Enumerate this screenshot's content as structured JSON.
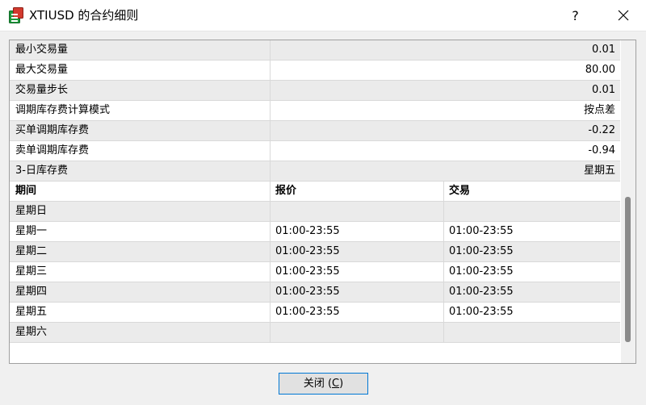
{
  "window": {
    "title": "XTIUSD 的合约细则",
    "help_label": "?"
  },
  "specs": [
    {
      "label": "最小交易量",
      "value": "0.01"
    },
    {
      "label": "最大交易量",
      "value": "80.00"
    },
    {
      "label": "交易量步长",
      "value": "0.01"
    },
    {
      "label": "调期库存费计算模式",
      "value": "按点差"
    },
    {
      "label": "买单调期库存费",
      "value": "-0.22"
    },
    {
      "label": "卖单调期库存费",
      "value": "-0.94"
    },
    {
      "label": "3-日库存费",
      "value": "星期五"
    }
  ],
  "sessions": {
    "headers": [
      "期间",
      "报价",
      "交易"
    ],
    "rows": [
      {
        "day": "星期日",
        "quote": "",
        "trade": ""
      },
      {
        "day": "星期一",
        "quote": "01:00-23:55",
        "trade": "01:00-23:55"
      },
      {
        "day": "星期二",
        "quote": "01:00-23:55",
        "trade": "01:00-23:55"
      },
      {
        "day": "星期三",
        "quote": "01:00-23:55",
        "trade": "01:00-23:55"
      },
      {
        "day": "星期四",
        "quote": "01:00-23:55",
        "trade": "01:00-23:55"
      },
      {
        "day": "星期五",
        "quote": "01:00-23:55",
        "trade": "01:00-23:55"
      },
      {
        "day": "星期六",
        "quote": "",
        "trade": ""
      }
    ]
  },
  "footer": {
    "close_label": "关闭 (",
    "close_mnemonic": "C",
    "close_suffix": ")"
  },
  "icons": {
    "app": "app-icon",
    "help": "help-icon",
    "close": "close-icon"
  },
  "colors": {
    "accent": "#0078d4",
    "row_gray": "#ebebeb",
    "icon_green": "#1e9a3c",
    "icon_red": "#d23a2e"
  }
}
